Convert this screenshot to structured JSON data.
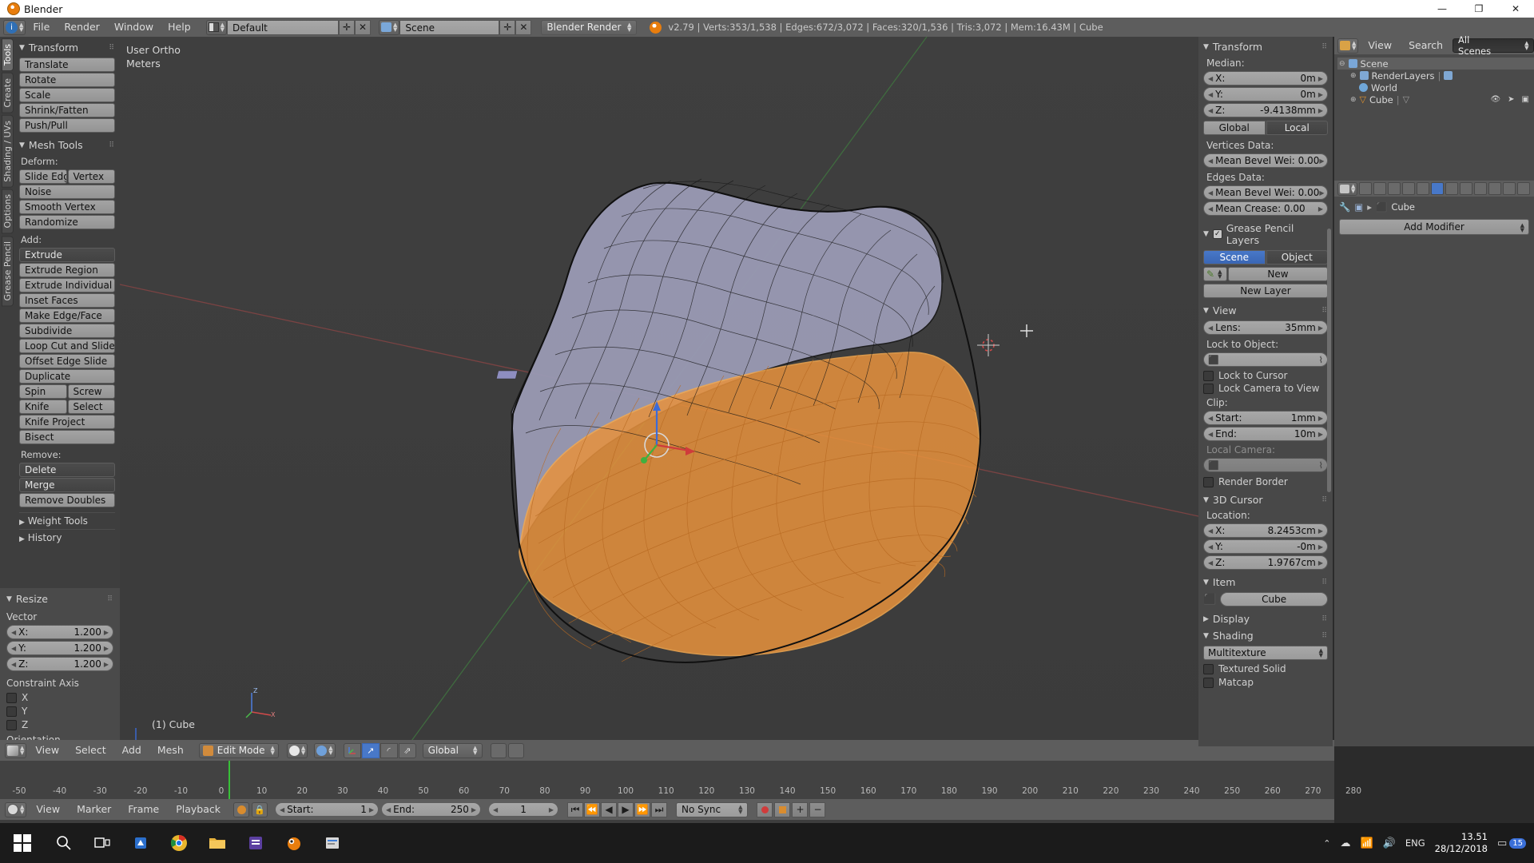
{
  "window": {
    "title": "Blender",
    "controls": [
      "—",
      "❐",
      "✕"
    ]
  },
  "info_header": {
    "menus": [
      "File",
      "Render",
      "Window",
      "Help"
    ],
    "screen_layout": "Default",
    "scene_name": "Scene",
    "engine": "Blender Render",
    "stats": "v2.79 | Verts:353/1,538 | Edges:672/3,072 | Faces:320/1,536 | Tris:3,072 | Mem:16.43M | Cube"
  },
  "toolshelf": {
    "tabs": [
      "Tools",
      "Create",
      "Shading / UVs",
      "Options",
      "Grease Pencil"
    ],
    "active_tab": "Tools",
    "transform": {
      "title": "Transform",
      "buttons": [
        "Translate",
        "Rotate",
        "Scale",
        "Shrink/Fatten",
        "Push/Pull"
      ]
    },
    "mesh_tools": {
      "title": "Mesh Tools",
      "deform_label": "Deform:",
      "deform_pair": [
        "Slide Edg",
        "Vertex"
      ],
      "deform_rest": [
        "Noise",
        "Smooth Vertex",
        "Randomize"
      ],
      "add_label": "Add:",
      "add_items": [
        "Extrude",
        "Extrude Region",
        "Extrude Individual",
        "Inset Faces",
        "Make Edge/Face",
        "Subdivide",
        "Loop Cut and Slide",
        "Offset Edge Slide",
        "Duplicate"
      ],
      "add_pairs": [
        [
          "Spin",
          "Screw"
        ],
        [
          "Knife",
          "Select"
        ]
      ],
      "add_tail": [
        "Knife Project",
        "Bisect"
      ],
      "remove_label": "Remove:",
      "remove_items": [
        "Delete",
        "Merge",
        "Remove Doubles"
      ],
      "collapsed": [
        "Weight Tools",
        "History"
      ]
    }
  },
  "operator_panel": {
    "title": "Resize",
    "vector_label": "Vector",
    "vector": [
      {
        "axis": "X:",
        "value": "1.200"
      },
      {
        "axis": "Y:",
        "value": "1.200"
      },
      {
        "axis": "Z:",
        "value": "1.200"
      }
    ],
    "constraint_label": "Constraint Axis",
    "constraint_axes": [
      "X",
      "Y",
      "Z"
    ],
    "orientation_label": "Orientation"
  },
  "viewport": {
    "view_name": "User Ortho",
    "unit": "Meters",
    "object_info": "(1) Cube",
    "axis_labels": [
      "X",
      "Y",
      "Z"
    ]
  },
  "viewport_header": {
    "menus": [
      "View",
      "Select",
      "Add",
      "Mesh"
    ],
    "mode": "Edit Mode",
    "orientation": "Global"
  },
  "timeline": {
    "menus": [
      "View",
      "Marker",
      "Frame",
      "Playback"
    ],
    "start_label": "Start:",
    "start_value": "1",
    "end_label": "End:",
    "end_value": "250",
    "current_frame": "1",
    "sync_mode": "No Sync",
    "ruler_ticks": [
      "-50",
      "-40",
      "-30",
      "-20",
      "-10",
      "0",
      "10",
      "20",
      "30",
      "40",
      "50",
      "60",
      "70",
      "80",
      "90",
      "100",
      "110",
      "120",
      "130",
      "140",
      "150",
      "160",
      "170",
      "180",
      "190",
      "200",
      "210",
      "220",
      "230",
      "240",
      "250",
      "260",
      "270",
      "280"
    ]
  },
  "npanel": {
    "transform": {
      "title": "Transform",
      "median_label": "Median:",
      "median": [
        {
          "axis": "X:",
          "value": "0m"
        },
        {
          "axis": "Y:",
          "value": "0m"
        },
        {
          "axis": "Z:",
          "value": "-9.4138mm"
        }
      ],
      "space_toggle": [
        "Global",
        "Local"
      ],
      "space_active": "Local",
      "vertices_data_label": "Vertices Data:",
      "vertex_bevel": "Mean Bevel Wei: 0.00",
      "edges_data_label": "Edges Data:",
      "edge_bevel": "Mean Bevel Wei: 0.00",
      "edge_crease": "Mean Crease:        0.00"
    },
    "grease_pencil": {
      "title": "Grease Pencil Layers",
      "toggle": [
        "Scene",
        "Object"
      ],
      "toggle_active": "Scene",
      "new_button": "New",
      "new_layer_button": "New Layer"
    },
    "view": {
      "title": "View",
      "lens_label": "Lens:",
      "lens_value": "35mm",
      "lock_to_object_label": "Lock to Object:",
      "lock_object_value": "",
      "lock_to_cursor": "Lock to Cursor",
      "lock_camera_to_view": "Lock Camera to View",
      "clip_label": "Clip:",
      "clip_start_label": "Start:",
      "clip_start_value": "1mm",
      "clip_end_label": "End:",
      "clip_end_value": "10m",
      "local_camera_label": "Local Camera:",
      "render_border": "Render Border"
    },
    "cursor": {
      "title": "3D Cursor",
      "location_label": "Location:",
      "location": [
        {
          "axis": "X:",
          "value": "8.2453cm"
        },
        {
          "axis": "Y:",
          "value": "-0m"
        },
        {
          "axis": "Z:",
          "value": "1.9767cm"
        }
      ]
    },
    "item": {
      "title": "Item",
      "object_name": "Cube"
    },
    "display": {
      "title": "Display"
    },
    "shading": {
      "title": "Shading",
      "mode": "Multitexture",
      "textured_solid": "Textured Solid",
      "matcap": "Matcap"
    }
  },
  "outliner": {
    "menus": [
      "View",
      "Search"
    ],
    "filter": "All Scenes",
    "rows": [
      {
        "label": "Scene",
        "depth": 0,
        "selected": true
      },
      {
        "label": "RenderLayers",
        "depth": 1,
        "selected": false
      },
      {
        "label": "World",
        "depth": 1,
        "selected": false
      },
      {
        "label": "Cube",
        "depth": 1,
        "selected": false
      }
    ]
  },
  "properties": {
    "breadcrumb_scene": "",
    "object_name": "Cube",
    "add_modifier": "Add Modifier"
  },
  "taskbar": {
    "language": "ENG",
    "time": "13.51",
    "date": "28/12/2018",
    "notification_count": "15"
  }
}
